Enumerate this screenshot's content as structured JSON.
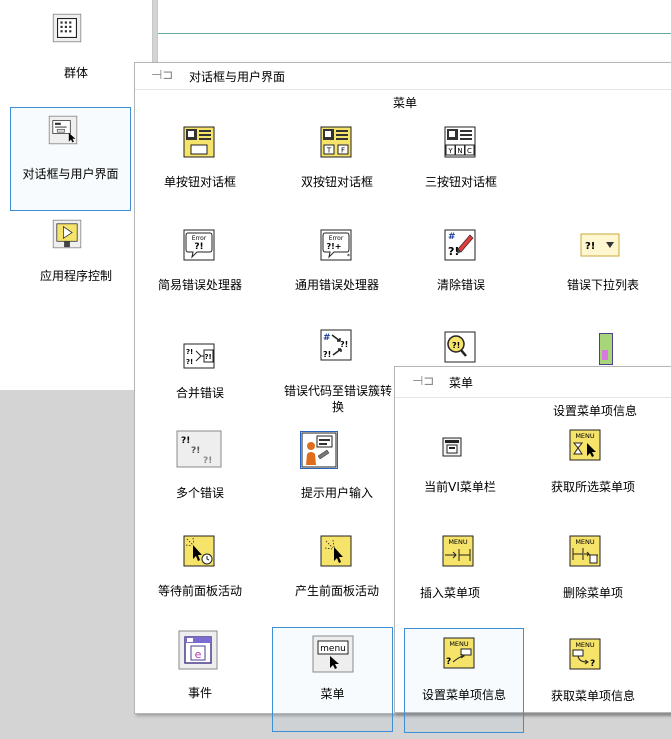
{
  "left_palette": {
    "items": [
      {
        "label": "群体"
      },
      {
        "label": "对话框与用户界面"
      },
      {
        "label": "应用程序控制"
      }
    ]
  },
  "dialog_palette": {
    "title": "对话框与用户界面",
    "subheader": "菜单",
    "items": [
      {
        "label": "单按钮对话框"
      },
      {
        "label": "双按钮对话框"
      },
      {
        "label": "三按钮对话框"
      },
      {
        "label": "简易错误处理器"
      },
      {
        "label": "通用错误处理器"
      },
      {
        "label": "清除错误"
      },
      {
        "label": "错误下拉列表"
      },
      {
        "label": "合并错误"
      },
      {
        "label": "错误代码至错误簇转换"
      },
      {
        "label": "多个错误"
      },
      {
        "label": "提示用户输入"
      },
      {
        "label": "等待前面板活动"
      },
      {
        "label": "产生前面板活动"
      },
      {
        "label": "事件"
      },
      {
        "label": "菜单"
      }
    ]
  },
  "menu_palette": {
    "title": "菜单",
    "subheader": "设置菜单项信息",
    "items": [
      {
        "label": "当前VI菜单栏"
      },
      {
        "label": "获取所选菜单项"
      },
      {
        "label": "插入菜单项"
      },
      {
        "label": "删除菜单项"
      },
      {
        "label": "设置菜单项信息"
      },
      {
        "label": "获取菜单项信息"
      }
    ]
  },
  "colors": {
    "selection": "#3c8fd7",
    "icon_yellow": "#f6e36a",
    "palette_bg": "#ffffff"
  }
}
